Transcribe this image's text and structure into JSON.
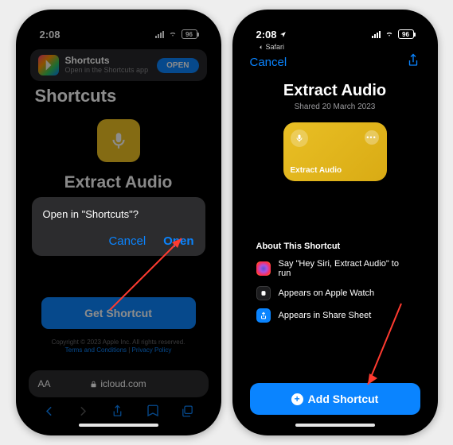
{
  "left": {
    "status": {
      "time": "2:08",
      "battery": "96"
    },
    "banner": {
      "title": "Shortcuts",
      "subtitle": "Open in the Shortcuts app",
      "action": "OPEN"
    },
    "page_title": "Shortcuts",
    "hero_title": "Extract Audio",
    "get_button": "Get Shortcut",
    "footer": {
      "copyright": "Copyright © 2023 Apple Inc. All rights reserved.",
      "terms": "Terms and Conditions",
      "privacy": "Privacy Policy"
    },
    "url": "icloud.com",
    "aa": "AA",
    "alert": {
      "message": "Open in \"Shortcuts\"?",
      "cancel": "Cancel",
      "open": "Open"
    }
  },
  "right": {
    "status": {
      "time": "2:08",
      "battery": "96"
    },
    "back_app": "Safari",
    "cancel": "Cancel",
    "title": "Extract Audio",
    "shared": "Shared 20 March 2023",
    "card_title": "Extract Audio",
    "about_heading": "About This Shortcut",
    "about": {
      "siri": "Say \"Hey Siri, Extract Audio\" to run",
      "watch": "Appears on Apple Watch",
      "share": "Appears in Share Sheet"
    },
    "add_button": "Add Shortcut"
  }
}
